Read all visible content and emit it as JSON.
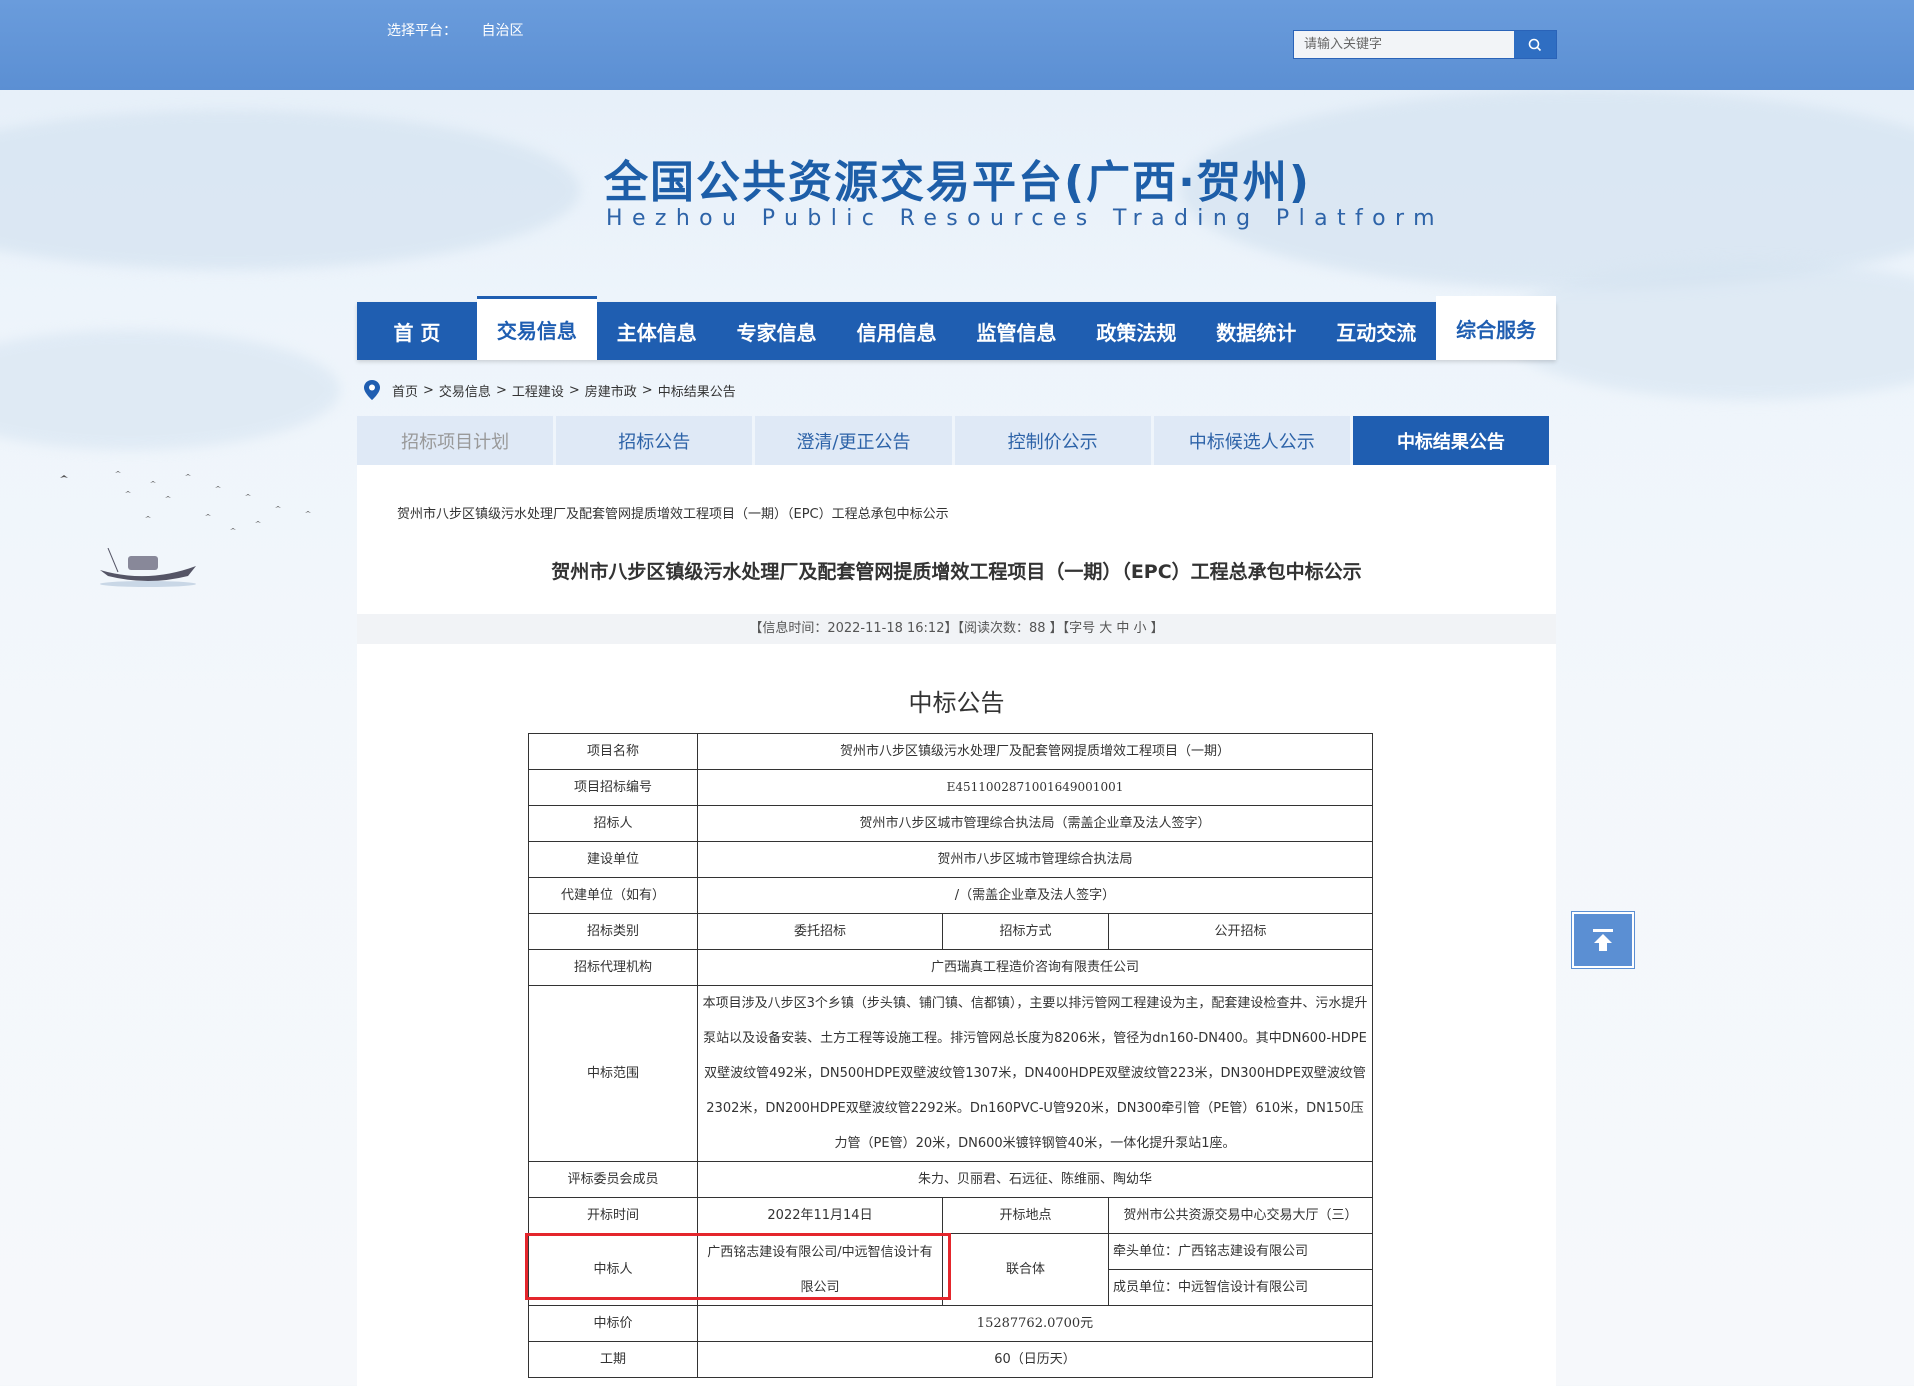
{
  "platform": {
    "label": "选择平台：",
    "value": "自治区"
  },
  "search": {
    "placeholder": "请输入关键字"
  },
  "site": {
    "title_cn": "全国公共资源交易平台(广西·贺州)",
    "title_en": "Hezhou Public Resources Trading Platform"
  },
  "nav": [
    "首 页",
    "交易信息",
    "主体信息",
    "专家信息",
    "信用信息",
    "监管信息",
    "政策法规",
    "数据统计",
    "互动交流",
    "综合服务"
  ],
  "breadcrumb": [
    "首页",
    "交易信息",
    "工程建设",
    "房建市政",
    "中标结果公告"
  ],
  "breadcrumb_sep": ">",
  "subtabs": [
    "招标项目计划",
    "招标公告",
    "澄清/更正公告",
    "控制价公示",
    "中标候选人公示",
    "中标结果公告"
  ],
  "article": {
    "small_title": "贺州市八步区镇级污水处理厂及配套管网提质增效工程项目（一期）（EPC）工程总承包中标公示",
    "title": "贺州市八步区镇级污水处理厂及配套管网提质增效工程项目（一期）（EPC）工程总承包中标公示",
    "meta": "【信息时间：2022-11-18 16:12】【阅读次数：88 】【字号 大 中 小 】",
    "notice_title": "中标公告"
  },
  "table": {
    "project_name_k": "项目名称",
    "project_name_v": "贺州市八步区镇级污水处理厂及配套管网提质增效工程项目（一期）",
    "code_k": "项目招标编号",
    "code_v": "E4511002871001649001001",
    "tenderer_k": "招标人",
    "tenderer_v": "贺州市八步区城市管理综合执法局（需盖企业章及法人签字）",
    "builder_k": "建设单位",
    "builder_v": "贺州市八步区城市管理综合执法局",
    "agent_build_k": "代建单位（如有）",
    "agent_build_v": "/（需盖企业章及法人签字）",
    "type_k": "招标类别",
    "type_v": "委托招标",
    "method_k": "招标方式",
    "method_v": "公开招标",
    "agency_k": "招标代理机构",
    "agency_v": "广西瑞真工程造价咨询有限责任公司",
    "scope_k": "中标范围",
    "scope_v": "本项目涉及八步区3个乡镇（步头镇、铺门镇、信都镇），主要以排污管网工程建设为主，配套建设检查井、污水提升泵站以及设备安装、土方工程等设施工程。排污管网总长度为8206米，管径为dn160-DN400。其中DN600-HDPE双壁波纹管492米，DN500HDPE双壁波纹管1307米，DN400HDPE双壁波纹管223米，DN300HDPE双壁波纹管2302米，DN200HDPE双壁波纹管2292米。Dn160PVC-U管920米，DN300牵引管（PE管）610米，DN150压力管（PE管）20米，DN600米镀锌钢管40米，一体化提升泵站1座。",
    "committee_k": "评标委员会成员",
    "committee_v": "朱力、贝丽君、石远征、陈维丽、陶幼华",
    "open_time_k": "开标时间",
    "open_time_v": "2022年11月14日",
    "open_place_k": "开标地点",
    "open_place_v": "贺州市公共资源交易中心交易大厅（三）",
    "winner_k": "中标人",
    "winner_v": "广西铭志建设有限公司/中远智信设计有限公司",
    "consortium_k": "联合体",
    "lead_v": "牵头单位：广西铭志建设有限公司",
    "member_v": "成员单位：中远智信设计有限公司",
    "price_k": "中标价",
    "price_v": "15287762.0700元",
    "period_k": "工期",
    "period_v": "60（日历天）"
  },
  "colors": {
    "brand": "#1f5eb1",
    "highlight": "#e4262c"
  }
}
